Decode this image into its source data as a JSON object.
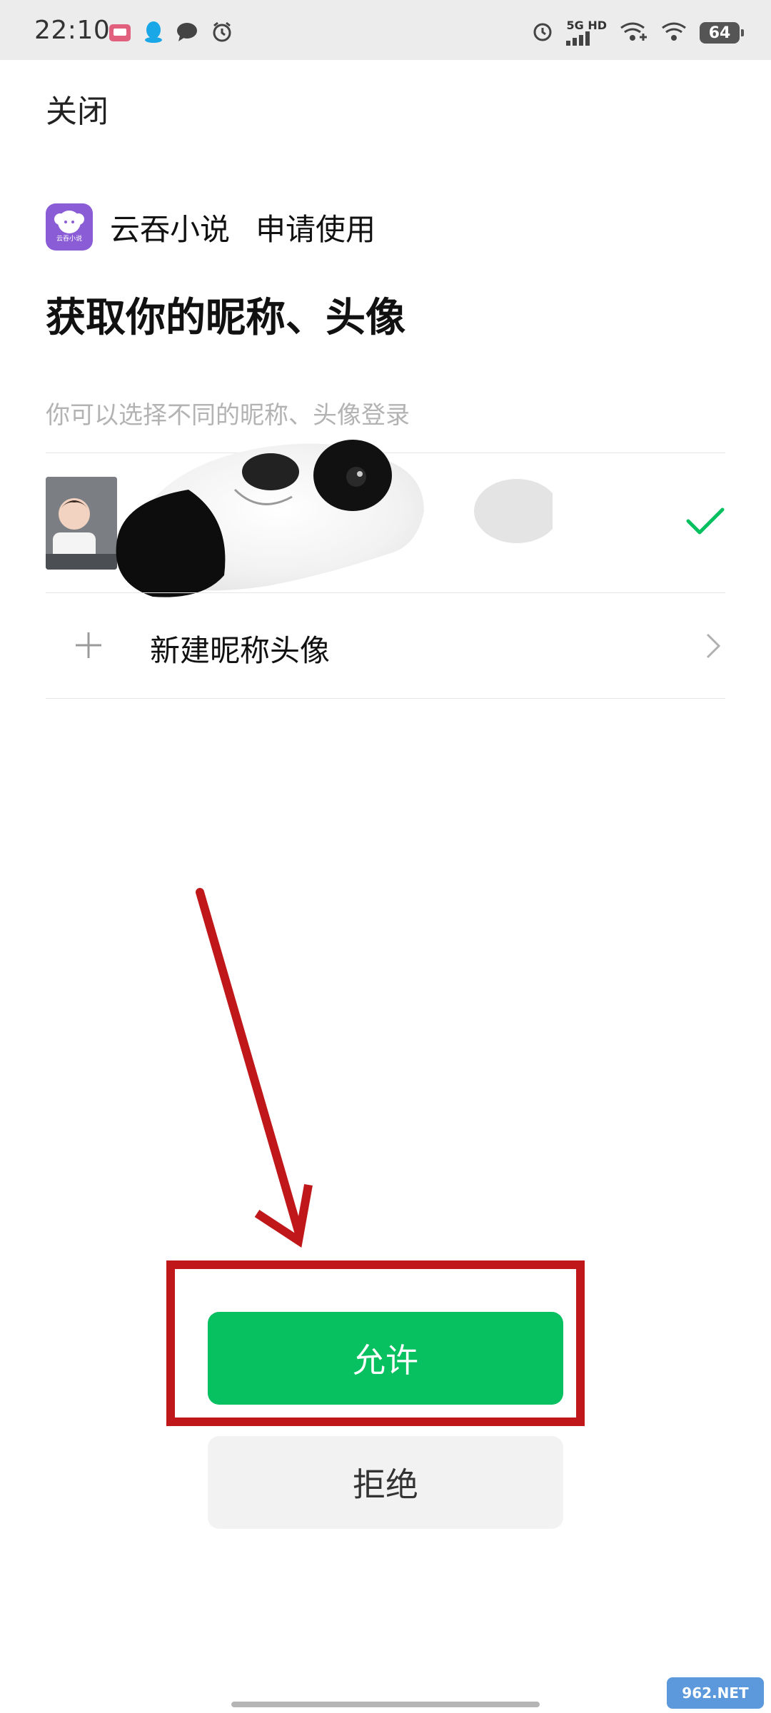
{
  "status_bar": {
    "time": "22:10",
    "network": "5G HD",
    "battery": "64",
    "left_icons": [
      "bilibili-icon",
      "qq-icon",
      "message-icon",
      "alarm-icon"
    ],
    "right_icons": [
      "alarm-icon",
      "signal-icon",
      "wifi-plus-icon",
      "wifi-icon",
      "battery-icon"
    ]
  },
  "header": {
    "close_label": "关闭"
  },
  "app": {
    "name": "云吞小说",
    "logo_text": "云吞小说",
    "request_text": "申请使用",
    "logo_color": "#8a5cd6"
  },
  "main": {
    "title": "获取你的昵称、头像",
    "subtitle": "你可以选择不同的昵称、头像登录"
  },
  "options": {
    "profile_selected": true,
    "new_profile_label": "新建昵称头像"
  },
  "buttons": {
    "allow_label": "允许",
    "deny_label": "拒绝"
  },
  "colors": {
    "primary_green": "#07c160",
    "annotation_red": "#c0181a",
    "secondary_button_bg": "#f2f2f2"
  },
  "watermark": {
    "text": "962.NET"
  }
}
